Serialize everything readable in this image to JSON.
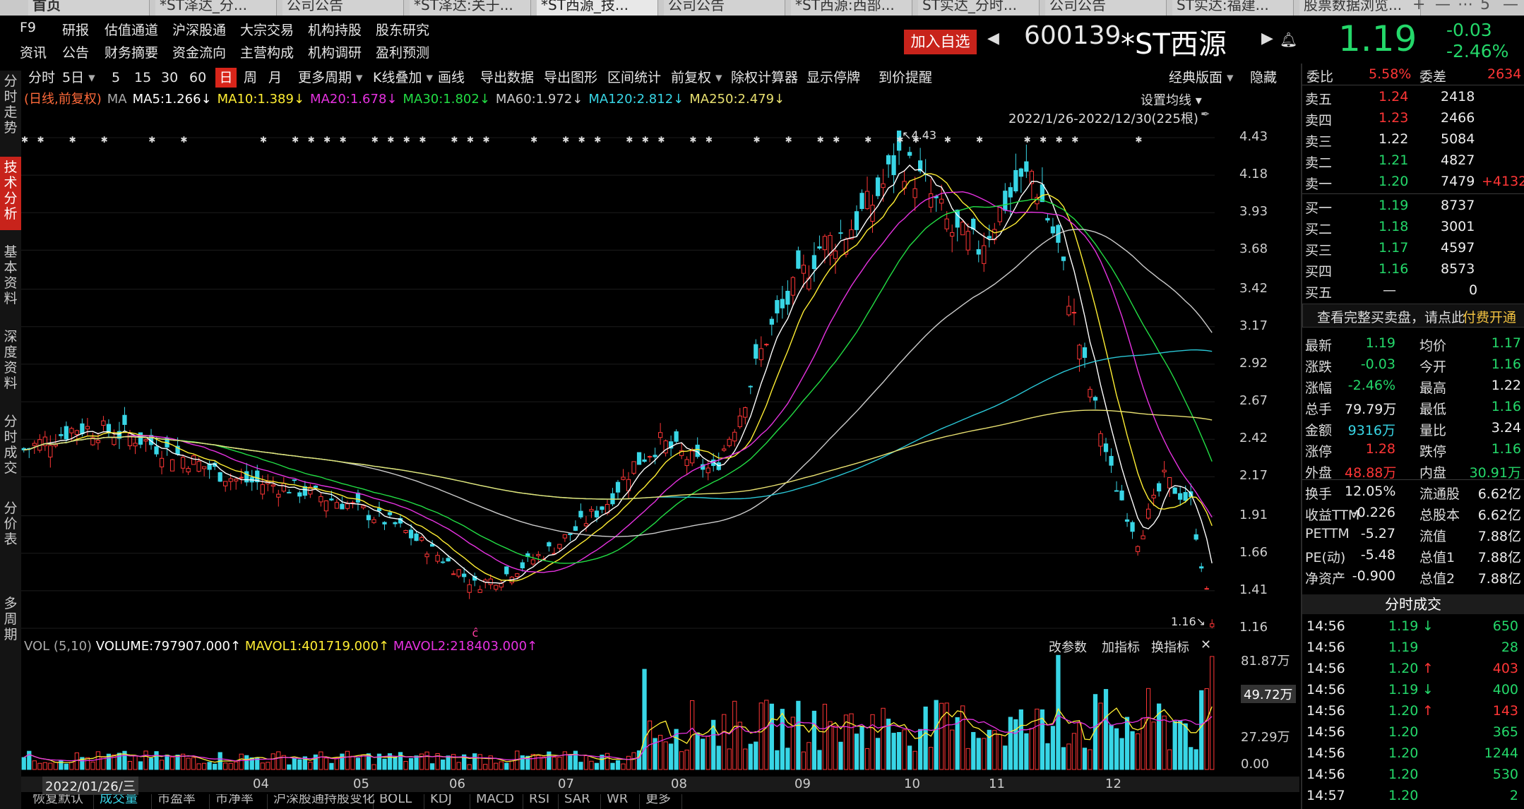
{
  "tabs": [
    "首页",
    "*ST泽达_分...",
    "公司公告",
    "*ST泽达:关于...",
    "*ST西源_技...",
    "公司公告",
    "*ST西源:西部...",
    "ST实达_分时...",
    "公司公告",
    "ST实达:福建...",
    "股票数据浏览..."
  ],
  "tab_controls": [
    "+",
    "—",
    "⋯",
    "5",
    "—"
  ],
  "menu_row1": [
    "F9",
    "研报",
    "估值通道",
    "沪深股通",
    "大宗交易",
    "机构持股",
    "股东研究"
  ],
  "menu_row2": [
    "资讯",
    "公告",
    "财务摘要",
    "资金流向",
    "主营构成",
    "机构调研",
    "盈利预测"
  ],
  "header": {
    "add_btn": "加入自选",
    "code": "600139",
    "name": "*ST西源",
    "price": "1.19",
    "change": "-0.03",
    "pct": "-2.46%"
  },
  "left_nav": [
    "分时走势",
    "技术分析",
    "基本资料",
    "深度资料",
    "分时成交",
    "分价表",
    "多周期"
  ],
  "toolbar": [
    "分时",
    "5日",
    "5",
    "15",
    "30",
    "60",
    "日",
    "周",
    "月",
    "更多周期",
    "K线叠加",
    "画线",
    "导出数据",
    "导出图形",
    "区间统计",
    "前复权",
    "除权计算器",
    "显示停牌",
    "到价提醒",
    "经典版面",
    "隐藏"
  ],
  "ma_line": {
    "prefix": "(日线,前复权)",
    "ma": "MA",
    "ma5": "MA5:1.266↓",
    "ma10": "MA10:1.389↓",
    "ma20": "MA20:1.678↓",
    "ma30": "MA30:1.802↓",
    "ma60": "MA60:1.972↓",
    "ma120": "MA120:2.812↓",
    "ma250": "MA250:2.479↓"
  },
  "set_ma": "设置均线",
  "range": "2022/1/26-2022/12/30(225根)",
  "price_axis": [
    "4.43",
    "4.18",
    "3.93",
    "3.68",
    "3.42",
    "3.17",
    "2.92",
    "2.67",
    "2.42",
    "2.17",
    "1.91",
    "1.66",
    "1.41",
    "1.16"
  ],
  "hi_label": "↖4.43",
  "lo_label": "1.16↘",
  "c_mark": "ĉ",
  "volume": {
    "label": "VOL (5,10)",
    "vol": "VOLUME:797907.000↑",
    "m1": "MAVOL1:401719.000↑",
    "m2": "MAVOL2:218403.000↑",
    "btns": [
      "改参数",
      "加指标",
      "换指标",
      "✕"
    ],
    "axis": [
      "81.87万",
      "49.72万",
      "27.29万",
      "0.00"
    ]
  },
  "months": [
    "2022/01/26/三",
    "04",
    "05",
    "06",
    "07",
    "08",
    "09",
    "10",
    "11",
    "12"
  ],
  "bottom_tabs": [
    "恢复默认",
    "成交量",
    "市盈率",
    "市净率",
    "沪深股通持股变化",
    "BOLL",
    "KDJ",
    "MACD",
    "RSI",
    "SAR",
    "WR",
    "更多"
  ],
  "orderbook": {
    "weibi": [
      "委比",
      "5.58%",
      "委差",
      "2634"
    ],
    "sell": [
      [
        "卖五",
        "1.24",
        "2418",
        ""
      ],
      [
        "卖四",
        "1.23",
        "2466",
        ""
      ],
      [
        "卖三",
        "1.22",
        "5084",
        ""
      ],
      [
        "卖二",
        "1.21",
        "4827",
        ""
      ],
      [
        "卖一",
        "1.20",
        "7479",
        "+4132"
      ]
    ],
    "buy": [
      [
        "买一",
        "1.19",
        "8737"
      ],
      [
        "买二",
        "1.18",
        "3001"
      ],
      [
        "买三",
        "1.17",
        "4597"
      ],
      [
        "买四",
        "1.16",
        "8573"
      ],
      [
        "买五",
        "—",
        "0"
      ]
    ],
    "promo": "查看完整买卖盘，请点此",
    "promo_link": "付费开通"
  },
  "stats": [
    [
      "最新",
      "1.19",
      "均价",
      "1.17"
    ],
    [
      "涨跌",
      "-0.03",
      "今开",
      "1.16"
    ],
    [
      "涨幅",
      "-2.46%",
      "最高",
      "1.22"
    ],
    [
      "总手",
      "79.79万",
      "最低",
      "1.16"
    ],
    [
      "金额",
      "9316万",
      "量比",
      "3.24"
    ],
    [
      "涨停",
      "1.28",
      "跌停",
      "1.16"
    ],
    [
      "外盘",
      "48.88万",
      "内盘",
      "30.91万"
    ],
    [
      "换手",
      "12.05%",
      "流通股",
      "6.62亿"
    ],
    [
      "收益TTM",
      "-0.226",
      "总股本",
      "6.62亿"
    ],
    [
      "PETTM",
      "-5.27",
      "流值",
      "7.88亿"
    ],
    [
      "PE(动)",
      "-5.48",
      "总值1",
      "7.88亿"
    ],
    [
      "净资产",
      "-0.900",
      "总值2",
      "7.88亿"
    ]
  ],
  "ticks_title": "分时成交",
  "ticks": [
    [
      "14:56",
      "1.19",
      "↓",
      "650"
    ],
    [
      "14:56",
      "1.19",
      "",
      "28"
    ],
    [
      "14:56",
      "1.20",
      "↑",
      "403"
    ],
    [
      "14:56",
      "1.19",
      "↓",
      "400"
    ],
    [
      "14:56",
      "1.20",
      "↑",
      "143"
    ],
    [
      "14:56",
      "1.20",
      "",
      "365"
    ],
    [
      "14:56",
      "1.20",
      "",
      "1244"
    ],
    [
      "14:56",
      "1.20",
      "",
      "530"
    ],
    [
      "14:57",
      "1.20",
      "",
      "2"
    ]
  ],
  "colors": {
    "up": "#ff3636",
    "down": "#24d86a",
    "cyan": "#38d6e6",
    "ma5": "#ffffff",
    "ma10": "#ffee33",
    "ma20": "#e632e0",
    "ma30": "#22dd44",
    "ma60": "#cccccc",
    "ma120": "#2ac7d6",
    "ma250": "#e8e070"
  },
  "chart_data": {
    "type": "candlestick",
    "period": "2022/1/26-2022/12/30",
    "bars": 225,
    "high": 4.43,
    "low": 1.16,
    "ylim": [
      1.16,
      4.43
    ],
    "close_path": [
      [
        0,
        2.35
      ],
      [
        10,
        2.5
      ],
      [
        20,
        2.45
      ],
      [
        30,
        2.3
      ],
      [
        40,
        2.15
      ],
      [
        50,
        2.1
      ],
      [
        60,
        2.0
      ],
      [
        70,
        1.85
      ],
      [
        80,
        1.6
      ],
      [
        85,
        1.45
      ],
      [
        90,
        1.5
      ],
      [
        100,
        1.7
      ],
      [
        110,
        2.0
      ],
      [
        115,
        2.25
      ],
      [
        120,
        2.4
      ],
      [
        130,
        2.2
      ],
      [
        135,
        2.6
      ],
      [
        140,
        3.1
      ],
      [
        145,
        3.4
      ],
      [
        150,
        3.7
      ],
      [
        155,
        3.8
      ],
      [
        160,
        4.0
      ],
      [
        165,
        4.3
      ],
      [
        170,
        4.1
      ],
      [
        175,
        3.8
      ],
      [
        180,
        3.7
      ],
      [
        185,
        4.0
      ],
      [
        190,
        4.2
      ],
      [
        195,
        3.7
      ],
      [
        200,
        2.9
      ],
      [
        205,
        2.2
      ],
      [
        210,
        1.75
      ],
      [
        215,
        2.15
      ],
      [
        220,
        2.0
      ],
      [
        224,
        1.19
      ]
    ]
  }
}
